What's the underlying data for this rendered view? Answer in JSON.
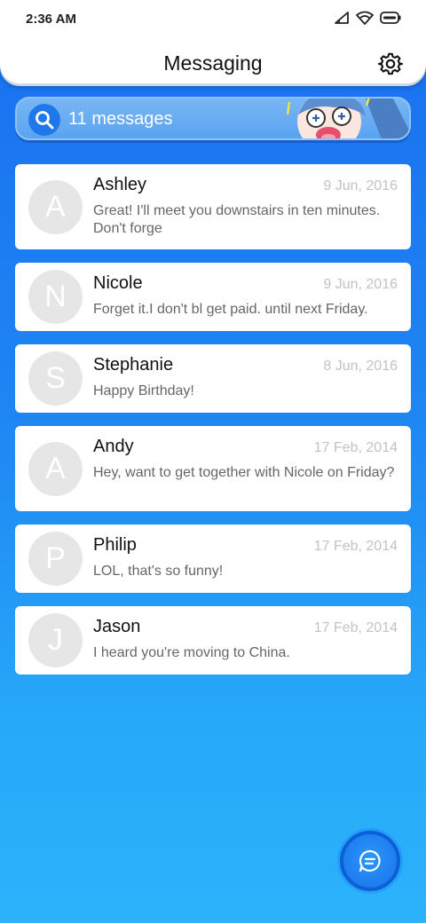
{
  "status_bar": {
    "time": "2:36 AM",
    "icons": [
      "signal-icon",
      "wifi-icon",
      "battery-icon"
    ]
  },
  "header": {
    "title": "Messaging",
    "settings_icon": "gear-icon"
  },
  "search": {
    "label": "11 messages",
    "icon": "search-icon"
  },
  "conversations": [
    {
      "initial": "A",
      "name": "Ashley",
      "date": "9 Jun, 2016",
      "preview": "Great! I'll meet you downstairs in ten minutes. Don't forge"
    },
    {
      "initial": "N",
      "name": "Nicole",
      "date": "9 Jun, 2016",
      "preview": "Forget it.I don't bl get paid. until next Friday."
    },
    {
      "initial": "S",
      "name": "Stephanie",
      "date": "8 Jun, 2016",
      "preview": "Happy Birthday!"
    },
    {
      "initial": "A",
      "name": "Andy",
      "date": "17 Feb, 2014",
      "preview": "Hey, want to get together with Nicole on Friday?"
    },
    {
      "initial": "P",
      "name": "Philip",
      "date": "17 Feb, 2014",
      "preview": "LOL, that's so funny!"
    },
    {
      "initial": "J",
      "name": "Jason",
      "date": "17 Feb, 2014",
      "preview": "I heard you're moving to China."
    }
  ],
  "fab": {
    "icon": "compose-message-icon"
  },
  "colors": {
    "accent": "#1a6ff0",
    "background_bottom": "#2bb3fb",
    "card": "#ffffff",
    "avatar": "#e6e6e6"
  }
}
